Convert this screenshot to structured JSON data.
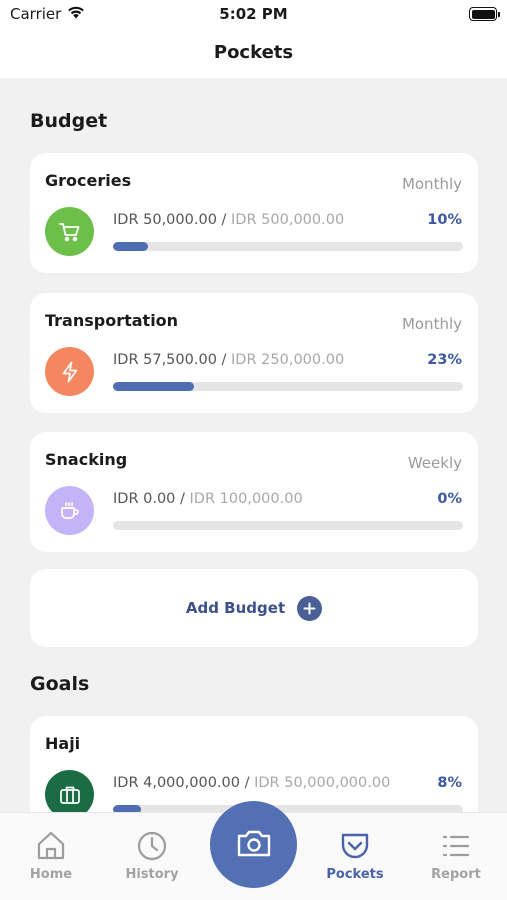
{
  "status_bar": {
    "carrier": "Carrier",
    "time": "5:02 PM"
  },
  "nav": {
    "title": "Pockets"
  },
  "budget_section": {
    "title": "Budget",
    "items": [
      {
        "name": "Groceries",
        "period": "Monthly",
        "spent": "IDR 50,000.00",
        "separator": " / ",
        "limit": "IDR 500,000.00",
        "percent": "10%",
        "progress": 0.1,
        "icon": "cart-icon",
        "color": "#6cc04a"
      },
      {
        "name": "Transportation",
        "period": "Monthly",
        "spent": "IDR 57,500.00",
        "separator": " / ",
        "limit": "IDR 250,000.00",
        "percent": "23%",
        "progress": 0.23,
        "icon": "lightning-icon",
        "color": "#f4875f"
      },
      {
        "name": "Snacking",
        "period": "Weekly",
        "spent": "IDR 0.00",
        "separator": " / ",
        "limit": "IDR 100,000.00",
        "percent": "0%",
        "progress": 0.0,
        "icon": "coffee-cup-icon",
        "color": "#c5b3f7"
      }
    ],
    "add_label": "Add Budget"
  },
  "goals_section": {
    "title": "Goals",
    "items": [
      {
        "name": "Haji",
        "spent": "IDR 4,000,000.00",
        "separator": " / ",
        "limit": "IDR 50,000,000.00",
        "percent": "8%",
        "progress": 0.08,
        "icon": "briefcase-icon",
        "color": "#1b6b45"
      }
    ]
  },
  "tabs": [
    {
      "label": "Home",
      "icon": "home-icon",
      "active": false
    },
    {
      "label": "History",
      "icon": "clock-icon",
      "active": false
    },
    {
      "label": "Pockets",
      "icon": "pocket-icon",
      "active": true
    },
    {
      "label": "Report",
      "icon": "list-icon",
      "active": false
    }
  ],
  "camera": {
    "icon": "camera-icon"
  },
  "colors": {
    "accent": "#5470b5",
    "progress": "#4f6db1",
    "background": "#f1f1f1"
  }
}
